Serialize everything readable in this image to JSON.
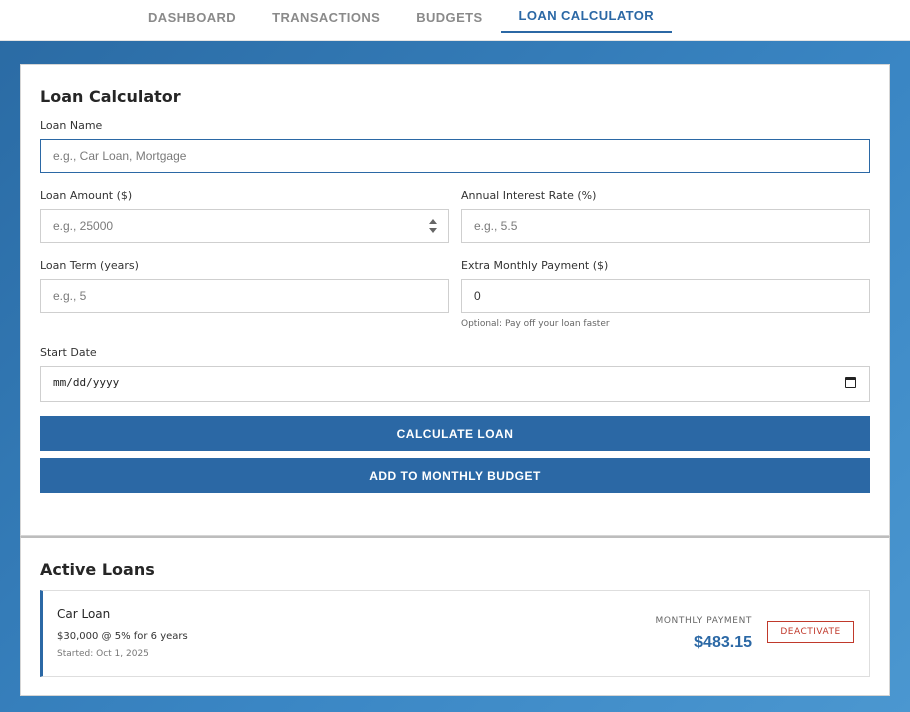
{
  "nav": {
    "tabs": [
      {
        "label": "DASHBOARD"
      },
      {
        "label": "TRANSACTIONS"
      },
      {
        "label": "BUDGETS"
      },
      {
        "label": "LOAN CALCULATOR"
      }
    ],
    "active_tab": "LOAN CALCULATOR"
  },
  "calculator": {
    "title": "Loan Calculator",
    "loan_name": {
      "label": "Loan Name",
      "placeholder": "e.g., Car Loan, Mortgage",
      "value": ""
    },
    "loan_amount": {
      "label": "Loan Amount ($)",
      "placeholder": "e.g., 25000",
      "value": ""
    },
    "interest_rate": {
      "label": "Annual Interest Rate (%)",
      "placeholder": "e.g., 5.5",
      "value": ""
    },
    "loan_term": {
      "label": "Loan Term (years)",
      "placeholder": "e.g., 5",
      "value": ""
    },
    "extra_payment": {
      "label": "Extra Monthly Payment ($)",
      "value": "0",
      "hint": "Optional: Pay off your loan faster"
    },
    "start_date": {
      "label": "Start Date",
      "value": "mm/dd/yyyy"
    },
    "calculate_button": "CALCULATE LOAN",
    "add_budget_button": "ADD TO MONTHLY BUDGET"
  },
  "active_loans": {
    "title": "Active Loans",
    "items": [
      {
        "name": "Car Loan",
        "terms": "$30,000 @ 5% for 6 years",
        "started": "Started: Oct 1, 2025",
        "payment_label": "MONTHLY PAYMENT",
        "payment_value": "$483.15",
        "deactivate_label": "DEACTIVATE"
      }
    ]
  },
  "colors": {
    "accent": "#2b68a5",
    "danger": "#c0392b"
  }
}
